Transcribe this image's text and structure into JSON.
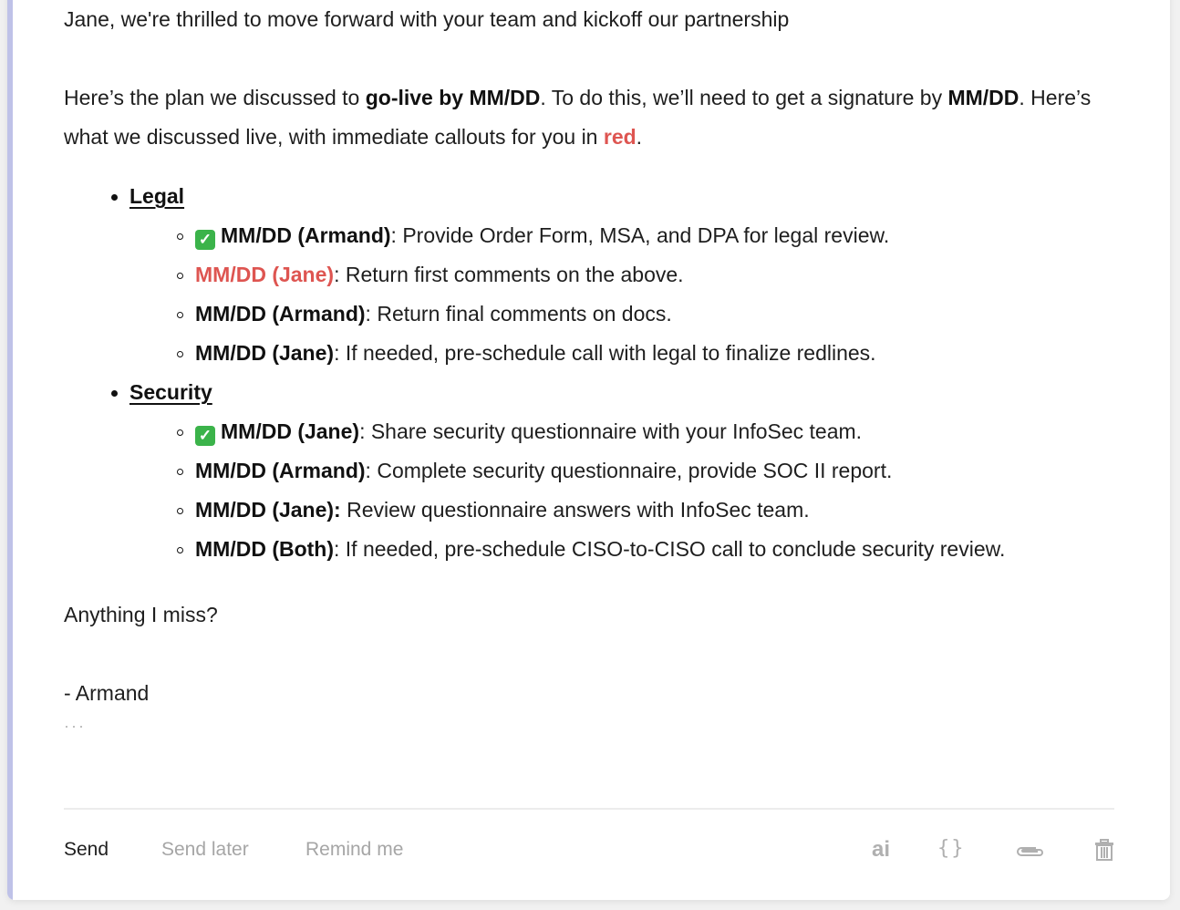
{
  "colors": {
    "accent_bar": "#bfc2e8",
    "callout_red": "#de5551",
    "text": "#1e1e1e",
    "muted": "#a6a6a6"
  },
  "email": {
    "greeting": "Jane, we're thrilled to move forward with your team and kickoff our partnership",
    "plan": {
      "t1": "Here’s the plan we discussed to ",
      "b1": "go-live by MM/DD",
      "t2": ". To do this, we’ll need to get a signature by ",
      "b2": "MM/DD",
      "t3": ". Here’s what we discussed live, with immediate callouts for you in ",
      "red": "red",
      "t4": "."
    },
    "sections": [
      {
        "title": "Legal",
        "items": [
          {
            "checked": true,
            "label": "MM/DD (Armand)",
            "sep": ":",
            "text": " Provide Order Form, MSA, and DPA for legal review.",
            "red": false
          },
          {
            "checked": false,
            "label": "MM/DD (Jane)",
            "sep": ":",
            "text": " Return first comments on the above.",
            "red": true
          },
          {
            "checked": false,
            "label": "MM/DD (Armand)",
            "sep": ":",
            "text": " Return final comments on docs.",
            "red": false
          },
          {
            "checked": false,
            "label": "MM/DD (Jane)",
            "sep": ":",
            "text": " If needed, pre-schedule call with legal to finalize redlines.",
            "red": false
          }
        ]
      },
      {
        "title": "Security",
        "items": [
          {
            "checked": true,
            "label": "MM/DD (Jane)",
            "sep": ":",
            "text": " Share security questionnaire with your InfoSec team.",
            "red": false
          },
          {
            "checked": false,
            "label": "MM/DD (Armand)",
            "sep": ":",
            "text": " Complete security questionnaire, provide SOC II report.",
            "red": false
          },
          {
            "checked": false,
            "label": "MM/DD (Jane):",
            "sep": "",
            "text": " Review questionnaire answers with InfoSec team.",
            "red": false
          },
          {
            "checked": false,
            "label": "MM/DD (Both)",
            "sep": ":",
            "text": " If needed, pre-schedule CISO-to-CISO call to conclude security review.",
            "red": false
          }
        ]
      }
    ],
    "closing_question": "Anything I miss?",
    "signature": "- Armand",
    "trimmed_content": "…"
  },
  "footer": {
    "send": "Send",
    "send_later": "Send later",
    "remind_me": "Remind me",
    "icons": {
      "ai": "ai",
      "snippets": "{}",
      "attach": "paperclip-icon",
      "delete": "trash-icon"
    }
  },
  "checkmark_glyph": "✓"
}
